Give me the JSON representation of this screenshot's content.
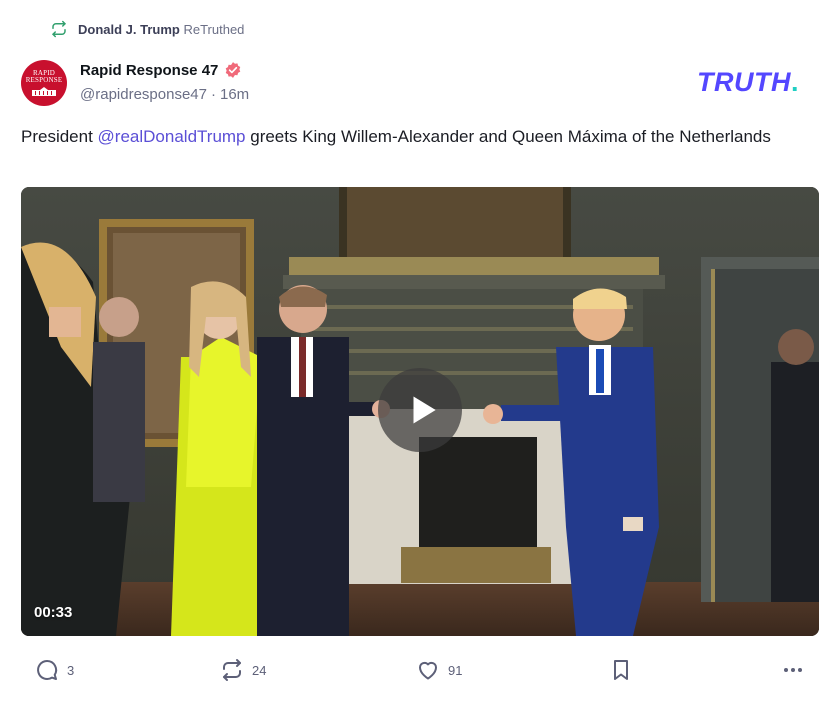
{
  "retruth": {
    "icon": "retruth-icon",
    "user": "Donald J. Trump",
    "action": "ReTruthed"
  },
  "author": {
    "avatar_lines": [
      "RAPID",
      "RESPONSE"
    ],
    "display_name": "Rapid Response 47",
    "verified_icon": "verified-badge-icon",
    "handle": "@rapidresponse47",
    "separator": "·",
    "time": "16m"
  },
  "brand": {
    "logo_text": "TRUTH",
    "logo_dot": ".",
    "logo_color": "#5447ff",
    "dot_color": "#20cfc3"
  },
  "post": {
    "text_before": "President ",
    "mention": "@realDonaldTrump",
    "text_after": " greets King Willem-Alexander and Queen Máxima of the Netherlands"
  },
  "media": {
    "type": "video",
    "play_icon": "play-icon",
    "duration": "00:33"
  },
  "actions": {
    "reply": {
      "icon": "reply-icon",
      "count": "3"
    },
    "retruth": {
      "icon": "retruth-icon",
      "count": "24"
    },
    "like": {
      "icon": "heart-icon",
      "count": "91"
    },
    "bookmark": {
      "icon": "bookmark-icon"
    },
    "more": {
      "icon": "more-icon"
    }
  }
}
